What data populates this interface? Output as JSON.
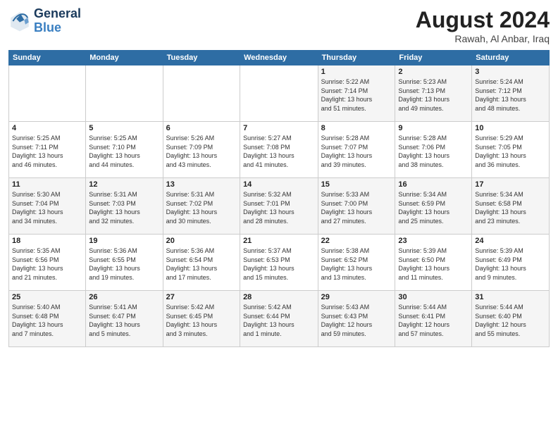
{
  "logo": {
    "line1": "General",
    "line2": "Blue"
  },
  "title": "August 2024",
  "subtitle": "Rawah, Al Anbar, Iraq",
  "weekdays": [
    "Sunday",
    "Monday",
    "Tuesday",
    "Wednesday",
    "Thursday",
    "Friday",
    "Saturday"
  ],
  "weeks": [
    [
      {
        "day": "",
        "detail": ""
      },
      {
        "day": "",
        "detail": ""
      },
      {
        "day": "",
        "detail": ""
      },
      {
        "day": "",
        "detail": ""
      },
      {
        "day": "1",
        "detail": "Sunrise: 5:22 AM\nSunset: 7:14 PM\nDaylight: 13 hours\nand 51 minutes."
      },
      {
        "day": "2",
        "detail": "Sunrise: 5:23 AM\nSunset: 7:13 PM\nDaylight: 13 hours\nand 49 minutes."
      },
      {
        "day": "3",
        "detail": "Sunrise: 5:24 AM\nSunset: 7:12 PM\nDaylight: 13 hours\nand 48 minutes."
      }
    ],
    [
      {
        "day": "4",
        "detail": "Sunrise: 5:25 AM\nSunset: 7:11 PM\nDaylight: 13 hours\nand 46 minutes."
      },
      {
        "day": "5",
        "detail": "Sunrise: 5:25 AM\nSunset: 7:10 PM\nDaylight: 13 hours\nand 44 minutes."
      },
      {
        "day": "6",
        "detail": "Sunrise: 5:26 AM\nSunset: 7:09 PM\nDaylight: 13 hours\nand 43 minutes."
      },
      {
        "day": "7",
        "detail": "Sunrise: 5:27 AM\nSunset: 7:08 PM\nDaylight: 13 hours\nand 41 minutes."
      },
      {
        "day": "8",
        "detail": "Sunrise: 5:28 AM\nSunset: 7:07 PM\nDaylight: 13 hours\nand 39 minutes."
      },
      {
        "day": "9",
        "detail": "Sunrise: 5:28 AM\nSunset: 7:06 PM\nDaylight: 13 hours\nand 38 minutes."
      },
      {
        "day": "10",
        "detail": "Sunrise: 5:29 AM\nSunset: 7:05 PM\nDaylight: 13 hours\nand 36 minutes."
      }
    ],
    [
      {
        "day": "11",
        "detail": "Sunrise: 5:30 AM\nSunset: 7:04 PM\nDaylight: 13 hours\nand 34 minutes."
      },
      {
        "day": "12",
        "detail": "Sunrise: 5:31 AM\nSunset: 7:03 PM\nDaylight: 13 hours\nand 32 minutes."
      },
      {
        "day": "13",
        "detail": "Sunrise: 5:31 AM\nSunset: 7:02 PM\nDaylight: 13 hours\nand 30 minutes."
      },
      {
        "day": "14",
        "detail": "Sunrise: 5:32 AM\nSunset: 7:01 PM\nDaylight: 13 hours\nand 28 minutes."
      },
      {
        "day": "15",
        "detail": "Sunrise: 5:33 AM\nSunset: 7:00 PM\nDaylight: 13 hours\nand 27 minutes."
      },
      {
        "day": "16",
        "detail": "Sunrise: 5:34 AM\nSunset: 6:59 PM\nDaylight: 13 hours\nand 25 minutes."
      },
      {
        "day": "17",
        "detail": "Sunrise: 5:34 AM\nSunset: 6:58 PM\nDaylight: 13 hours\nand 23 minutes."
      }
    ],
    [
      {
        "day": "18",
        "detail": "Sunrise: 5:35 AM\nSunset: 6:56 PM\nDaylight: 13 hours\nand 21 minutes."
      },
      {
        "day": "19",
        "detail": "Sunrise: 5:36 AM\nSunset: 6:55 PM\nDaylight: 13 hours\nand 19 minutes."
      },
      {
        "day": "20",
        "detail": "Sunrise: 5:36 AM\nSunset: 6:54 PM\nDaylight: 13 hours\nand 17 minutes."
      },
      {
        "day": "21",
        "detail": "Sunrise: 5:37 AM\nSunset: 6:53 PM\nDaylight: 13 hours\nand 15 minutes."
      },
      {
        "day": "22",
        "detail": "Sunrise: 5:38 AM\nSunset: 6:52 PM\nDaylight: 13 hours\nand 13 minutes."
      },
      {
        "day": "23",
        "detail": "Sunrise: 5:39 AM\nSunset: 6:50 PM\nDaylight: 13 hours\nand 11 minutes."
      },
      {
        "day": "24",
        "detail": "Sunrise: 5:39 AM\nSunset: 6:49 PM\nDaylight: 13 hours\nand 9 minutes."
      }
    ],
    [
      {
        "day": "25",
        "detail": "Sunrise: 5:40 AM\nSunset: 6:48 PM\nDaylight: 13 hours\nand 7 minutes."
      },
      {
        "day": "26",
        "detail": "Sunrise: 5:41 AM\nSunset: 6:47 PM\nDaylight: 13 hours\nand 5 minutes."
      },
      {
        "day": "27",
        "detail": "Sunrise: 5:42 AM\nSunset: 6:45 PM\nDaylight: 13 hours\nand 3 minutes."
      },
      {
        "day": "28",
        "detail": "Sunrise: 5:42 AM\nSunset: 6:44 PM\nDaylight: 13 hours\nand 1 minute."
      },
      {
        "day": "29",
        "detail": "Sunrise: 5:43 AM\nSunset: 6:43 PM\nDaylight: 12 hours\nand 59 minutes."
      },
      {
        "day": "30",
        "detail": "Sunrise: 5:44 AM\nSunset: 6:41 PM\nDaylight: 12 hours\nand 57 minutes."
      },
      {
        "day": "31",
        "detail": "Sunrise: 5:44 AM\nSunset: 6:40 PM\nDaylight: 12 hours\nand 55 minutes."
      }
    ]
  ]
}
